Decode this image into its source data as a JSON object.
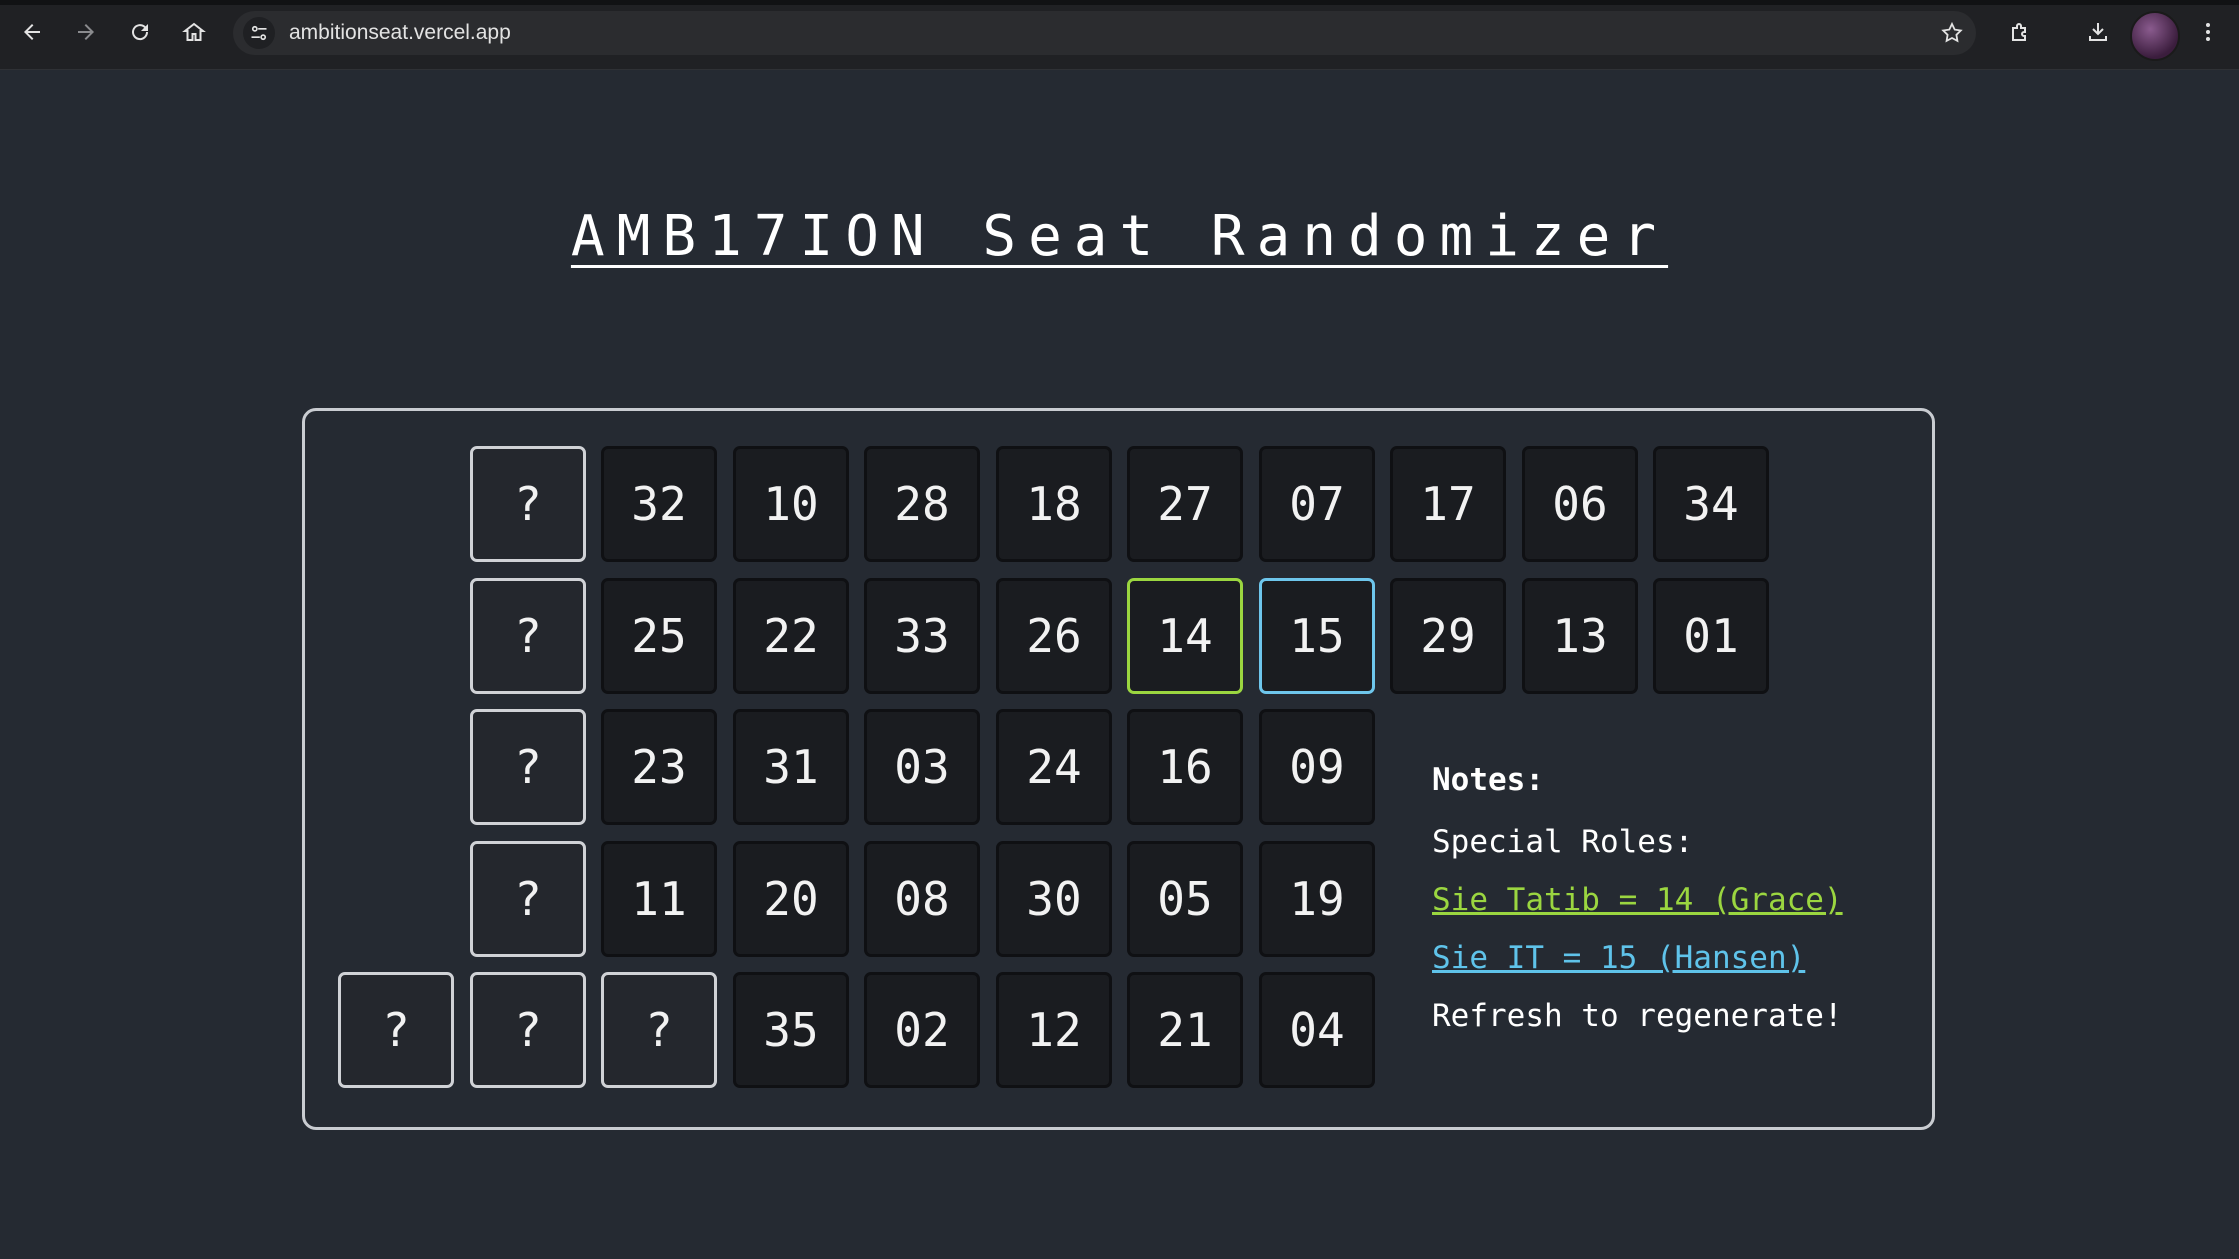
{
  "browser": {
    "url": "ambitionseat.vercel.app"
  },
  "page": {
    "title": "AMB17ION Seat Randomizer"
  },
  "seating": {
    "rows": [
      [
        "?",
        "32",
        "10",
        "28",
        "18",
        "27",
        "07",
        "17",
        "06",
        "34"
      ],
      [
        "?",
        "25",
        "22",
        "33",
        "26",
        "14",
        "15",
        "29",
        "13",
        "01"
      ],
      [
        "?",
        "23",
        "31",
        "03",
        "24",
        "16",
        "09"
      ],
      [
        "?",
        "11",
        "20",
        "08",
        "30",
        "05",
        "19"
      ],
      [
        "?",
        "?",
        "?",
        "35",
        "02",
        "12",
        "21",
        "04"
      ]
    ],
    "highlight_grace": "14",
    "highlight_hansen": "15"
  },
  "notes": {
    "heading": "Notes:",
    "special_roles": "Special Roles:",
    "grace_role": "Sie Tatib = 14 (Grace)",
    "hansen_role": "Sie IT = 15 (Hansen)",
    "refresh": "Refresh to regenerate!"
  },
  "colors": {
    "background": "#252a32",
    "grace": "#9bd640",
    "hansen": "#5fc3ea"
  }
}
